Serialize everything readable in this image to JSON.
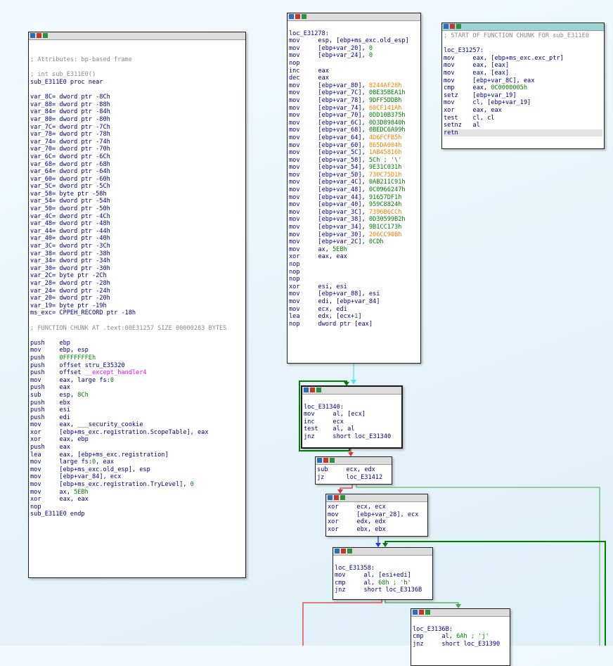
{
  "blocks": {
    "left": {
      "lines": [
        {
          "t": ""
        },
        {
          "t": ""
        },
        {
          "c": "cm",
          "t": "; Attributes: bp-based frame"
        },
        {
          "t": ""
        },
        {
          "c": "cm",
          "t": "; int sub_E311E0()"
        },
        {
          "c": "pr",
          "t": "sub_E311E0 proc near"
        },
        {
          "t": ""
        },
        {
          "c": "pr",
          "t": "var_8C= dword ptr -8Ch"
        },
        {
          "c": "pr",
          "t": "var_88= dword ptr -88h"
        },
        {
          "c": "pr",
          "t": "var_84= dword ptr -84h"
        },
        {
          "c": "pr",
          "t": "var_80= dword ptr -80h"
        },
        {
          "c": "pr",
          "t": "var_7C= dword ptr -7Ch"
        },
        {
          "c": "pr",
          "t": "var_78= dword ptr -78h"
        },
        {
          "c": "pr",
          "t": "var_74= dword ptr -74h"
        },
        {
          "c": "pr",
          "t": "var_70= dword ptr -70h"
        },
        {
          "c": "pr",
          "t": "var_6C= dword ptr -6Ch"
        },
        {
          "c": "pr",
          "t": "var_68= dword ptr -68h"
        },
        {
          "c": "pr",
          "t": "var_64= dword ptr -64h"
        },
        {
          "c": "pr",
          "t": "var_60= dword ptr -60h"
        },
        {
          "c": "pr",
          "t": "var_5C= dword ptr -5Ch"
        },
        {
          "c": "pr",
          "t": "var_58= byte ptr -58h"
        },
        {
          "c": "pr",
          "t": "var_54= dword ptr -54h"
        },
        {
          "c": "pr",
          "t": "var_50= dword ptr -50h"
        },
        {
          "c": "pr",
          "t": "var_4C= dword ptr -4Ch"
        },
        {
          "c": "pr",
          "t": "var_48= dword ptr -48h"
        },
        {
          "c": "pr",
          "t": "var_44= dword ptr -44h"
        },
        {
          "c": "pr",
          "t": "var_40= dword ptr -40h"
        },
        {
          "c": "pr",
          "t": "var_3C= dword ptr -3Ch"
        },
        {
          "c": "pr",
          "t": "var_38= dword ptr -38h"
        },
        {
          "c": "pr",
          "t": "var_34= dword ptr -34h"
        },
        {
          "c": "pr",
          "t": "var_30= dword ptr -30h"
        },
        {
          "c": "pr",
          "t": "var_2C= byte ptr -2Ch"
        },
        {
          "c": "pr",
          "t": "var_28= dword ptr -28h"
        },
        {
          "c": "pr",
          "t": "var_24= dword ptr -24h"
        },
        {
          "c": "pr",
          "t": "var_20= dword ptr -20h"
        },
        {
          "c": "pr",
          "t": "var_19= byte ptr -19h"
        },
        {
          "c": "pr",
          "t": "ms_exc= CPPEH_RECORD ptr -18h"
        },
        {
          "t": ""
        },
        {
          "c": "cm",
          "t": "; FUNCTION CHUNK AT .text:00E31257 SIZE 00000283 BYTES"
        },
        {
          "t": ""
        },
        {
          "m": "push",
          "a": [
            [
              "r",
              "ebp"
            ]
          ]
        },
        {
          "m": "mov",
          "a": [
            [
              "r",
              "ebp, esp"
            ]
          ]
        },
        {
          "m": "push",
          "a": [
            [
              "n",
              "0FFFFFFFEh"
            ]
          ]
        },
        {
          "m": "push",
          "a": [
            [
              "r",
              "offset stru_E35320"
            ]
          ]
        },
        {
          "m": "push",
          "a": [
            [
              "r",
              "offset "
            ],
            [
              "imp",
              "__except_handler4"
            ]
          ]
        },
        {
          "m": "mov",
          "a": [
            [
              "r",
              "eax, large fs:"
            ],
            [
              "n",
              "0"
            ]
          ]
        },
        {
          "m": "push",
          "a": [
            [
              "r",
              "eax"
            ]
          ]
        },
        {
          "m": "sub",
          "a": [
            [
              "r",
              "esp, "
            ],
            [
              "n",
              "8Ch"
            ]
          ]
        },
        {
          "m": "push",
          "a": [
            [
              "r",
              "ebx"
            ]
          ]
        },
        {
          "m": "push",
          "a": [
            [
              "r",
              "esi"
            ]
          ]
        },
        {
          "m": "push",
          "a": [
            [
              "r",
              "edi"
            ]
          ]
        },
        {
          "m": "mov",
          "a": [
            [
              "r",
              "eax, ___security_cookie"
            ]
          ]
        },
        {
          "m": "xor",
          "a": [
            [
              "r",
              "[ebp+ms_exc.registration.ScopeTable], eax"
            ]
          ]
        },
        {
          "m": "xor",
          "a": [
            [
              "r",
              "eax, ebp"
            ]
          ]
        },
        {
          "m": "push",
          "a": [
            [
              "r",
              "eax"
            ]
          ]
        },
        {
          "m": "lea",
          "a": [
            [
              "r",
              "eax, [ebp+ms_exc.registration]"
            ]
          ]
        },
        {
          "m": "mov",
          "a": [
            [
              "r",
              "large fs:"
            ],
            [
              "n",
              "0"
            ],
            [
              "r",
              ", eax"
            ]
          ]
        },
        {
          "m": "mov",
          "a": [
            [
              "r",
              "[ebp+ms_exc.old_esp], esp"
            ]
          ]
        },
        {
          "m": "mov",
          "a": [
            [
              "r",
              "[ebp+var_84], ecx"
            ]
          ]
        },
        {
          "m": "mov",
          "a": [
            [
              "r",
              "[ebp+ms_exc.registration.TryLevel], "
            ],
            [
              "n",
              "0"
            ]
          ]
        },
        {
          "m": "mov",
          "a": [
            [
              "r",
              "ax, "
            ],
            [
              "n",
              "5EBh"
            ]
          ]
        },
        {
          "m": "xor",
          "a": [
            [
              "r",
              "eax, eax"
            ]
          ]
        },
        {
          "m": "nop",
          "a": []
        },
        {
          "c": "pr",
          "t": "sub_E311E0 endp"
        }
      ]
    },
    "mid": {
      "lines": [
        {
          "t": ""
        },
        {
          "c": "lbl",
          "t": "loc_E31278:"
        },
        {
          "m": "mov",
          "a": [
            [
              "r",
              "esp, [ebp+ms_exc.old_esp]"
            ]
          ]
        },
        {
          "m": "mov",
          "a": [
            [
              "r",
              "[ebp+var_20], "
            ],
            [
              "n",
              "0"
            ]
          ]
        },
        {
          "m": "mov",
          "a": [
            [
              "r",
              "[ebp+var_24], "
            ],
            [
              "n",
              "0"
            ]
          ]
        },
        {
          "m": "nop",
          "a": []
        },
        {
          "m": "inc",
          "a": [
            [
              "r",
              "eax"
            ]
          ]
        },
        {
          "m": "dec",
          "a": [
            [
              "r",
              "eax"
            ]
          ]
        },
        {
          "m": "mov",
          "a": [
            [
              "r",
              "[ebp+var_80], "
            ],
            [
              "or",
              "8244AF28h"
            ]
          ]
        },
        {
          "m": "mov",
          "a": [
            [
              "r",
              "[ebp+var_7C], "
            ],
            [
              "n",
              "0BE35BEA1h"
            ]
          ]
        },
        {
          "m": "mov",
          "a": [
            [
              "r",
              "[ebp+var_78], "
            ],
            [
              "n",
              "9DFF5DDBh"
            ]
          ]
        },
        {
          "m": "mov",
          "a": [
            [
              "r",
              "[ebp+var_74], "
            ],
            [
              "or",
              "60CF141Ah"
            ]
          ]
        },
        {
          "m": "mov",
          "a": [
            [
              "r",
              "[ebp+var_70], "
            ],
            [
              "n",
              "0DD10B375h"
            ]
          ]
        },
        {
          "m": "mov",
          "a": [
            [
              "r",
              "[ebp+var_6C], "
            ],
            [
              "n",
              "0D3D89840h"
            ]
          ]
        },
        {
          "m": "mov",
          "a": [
            [
              "r",
              "[ebp+var_68], "
            ],
            [
              "n",
              "0BEDC6A99h"
            ]
          ]
        },
        {
          "m": "mov",
          "a": [
            [
              "r",
              "[ebp+var_64], "
            ],
            [
              "or",
              "4D6FCFB5h"
            ]
          ]
        },
        {
          "m": "mov",
          "a": [
            [
              "r",
              "[ebp+var_60], "
            ],
            [
              "or",
              "865DA004h"
            ]
          ]
        },
        {
          "m": "mov",
          "a": [
            [
              "r",
              "[ebp+var_5C], "
            ],
            [
              "or",
              "1AB45816h"
            ]
          ]
        },
        {
          "m": "mov",
          "a": [
            [
              "r",
              "[ebp+var_58], "
            ],
            [
              "n",
              "5Ch ; '\\'"
            ]
          ]
        },
        {
          "m": "mov",
          "a": [
            [
              "r",
              "[ebp+var_54], "
            ],
            [
              "n",
              "9E31C031h"
            ]
          ]
        },
        {
          "m": "mov",
          "a": [
            [
              "r",
              "[ebp+var_50], "
            ],
            [
              "or",
              "730C75D1h"
            ]
          ]
        },
        {
          "m": "mov",
          "a": [
            [
              "r",
              "[ebp+var_4C], "
            ],
            [
              "n",
              "0AB211C91h"
            ]
          ]
        },
        {
          "m": "mov",
          "a": [
            [
              "r",
              "[ebp+var_48], "
            ],
            [
              "n",
              "0C0966247h"
            ]
          ]
        },
        {
          "m": "mov",
          "a": [
            [
              "r",
              "[ebp+var_44], "
            ],
            [
              "n",
              "91657DF1h"
            ]
          ]
        },
        {
          "m": "mov",
          "a": [
            [
              "r",
              "[ebp+var_40], "
            ],
            [
              "n",
              "959C8824h"
            ]
          ]
        },
        {
          "m": "mov",
          "a": [
            [
              "r",
              "[ebp+var_3C], "
            ],
            [
              "or",
              "7396B6CCh"
            ]
          ]
        },
        {
          "m": "mov",
          "a": [
            [
              "r",
              "[ebp+var_38], "
            ],
            [
              "n",
              "0D30599B2h"
            ]
          ]
        },
        {
          "m": "mov",
          "a": [
            [
              "r",
              "[ebp+var_34], "
            ],
            [
              "n",
              "9B1CC173h"
            ]
          ]
        },
        {
          "m": "mov",
          "a": [
            [
              "r",
              "[ebp+var_30], "
            ],
            [
              "or",
              "206CC90Bh"
            ]
          ]
        },
        {
          "m": "mov",
          "a": [
            [
              "r",
              "[ebp+var_2C], "
            ],
            [
              "n",
              "0CDh"
            ]
          ]
        },
        {
          "m": "mov",
          "a": [
            [
              "r",
              "ax, "
            ],
            [
              "n",
              "5EBh"
            ]
          ]
        },
        {
          "m": "xor",
          "a": [
            [
              "r",
              "eax, eax"
            ]
          ]
        },
        {
          "m": "nop",
          "a": []
        },
        {
          "m": "nop",
          "a": []
        },
        {
          "m": "nop",
          "a": []
        },
        {
          "m": "xor",
          "a": [
            [
              "r",
              "esi, esi"
            ]
          ]
        },
        {
          "m": "mov",
          "a": [
            [
              "r",
              "[ebp+var_88], esi"
            ]
          ]
        },
        {
          "m": "mov",
          "a": [
            [
              "r",
              "edi, [ebp+var_84]"
            ]
          ]
        },
        {
          "m": "mov",
          "a": [
            [
              "r",
              "ecx, edi"
            ]
          ]
        },
        {
          "m": "lea",
          "a": [
            [
              "r",
              "edx, [ecx+"
            ],
            [
              "n",
              "1"
            ],
            [
              "r",
              "]"
            ]
          ]
        },
        {
          "m": "nop",
          "a": [
            [
              "r",
              "dword ptr [eax]"
            ]
          ]
        }
      ]
    },
    "right": {
      "lines": [
        {
          "c": "cm",
          "t": "; START OF FUNCTION CHUNK FOR sub_E311E0"
        },
        {
          "t": ""
        },
        {
          "c": "lbl",
          "t": "loc_E31257:"
        },
        {
          "m": "mov",
          "a": [
            [
              "r",
              "eax, [ebp+ms_exc.exc_ptr]"
            ]
          ]
        },
        {
          "m": "mov",
          "a": [
            [
              "r",
              "eax, [eax]"
            ]
          ]
        },
        {
          "m": "mov",
          "a": [
            [
              "r",
              "eax, [eax]"
            ]
          ]
        },
        {
          "m": "mov",
          "a": [
            [
              "r",
              "[ebp+var_8C], eax"
            ]
          ]
        },
        {
          "m": "cmp",
          "a": [
            [
              "r",
              "eax, "
            ],
            [
              "n",
              "0C0000005h"
            ]
          ]
        },
        {
          "m": "setz",
          "a": [
            [
              "r",
              "[ebp+var_19]"
            ]
          ]
        },
        {
          "m": "mov",
          "a": [
            [
              "r",
              "cl, [ebp+var_19]"
            ]
          ]
        },
        {
          "m": "xor",
          "a": [
            [
              "r",
              "eax, eax"
            ]
          ]
        },
        {
          "m": "test",
          "a": [
            [
              "r",
              "cl, cl"
            ]
          ]
        },
        {
          "m": "setnz",
          "a": [
            [
              "r",
              "al"
            ]
          ]
        },
        {
          "m": "retn",
          "a": [],
          "hl": true
        }
      ]
    },
    "b1340": {
      "lines": [
        {
          "t": ""
        },
        {
          "c": "lbl",
          "t": "loc_E31340:"
        },
        {
          "m": "mov",
          "a": [
            [
              "r",
              "al, [ecx]"
            ]
          ]
        },
        {
          "m": "inc",
          "a": [
            [
              "r",
              "ecx"
            ]
          ]
        },
        {
          "m": "test",
          "a": [
            [
              "r",
              "al, al"
            ]
          ]
        },
        {
          "m": "jnz",
          "a": [
            [
              "r",
              "short loc_E31340"
            ]
          ]
        }
      ]
    },
    "bsub": {
      "lines": [
        {
          "m": "sub",
          "a": [
            [
              "r",
              "ecx, edx"
            ]
          ]
        },
        {
          "m": "jz",
          "a": [
            [
              "r",
              "loc_E31412"
            ]
          ]
        }
      ]
    },
    "bxor": {
      "lines": [
        {
          "m": "xor",
          "a": [
            [
              "r",
              "ecx, ecx"
            ]
          ]
        },
        {
          "m": "mov",
          "a": [
            [
              "r",
              "[ebp+var_28], ecx"
            ]
          ]
        },
        {
          "m": "xor",
          "a": [
            [
              "r",
              "edx, edx"
            ]
          ]
        },
        {
          "m": "xor",
          "a": [
            [
              "r",
              "ebx, ebx"
            ]
          ]
        }
      ]
    },
    "b1358": {
      "lines": [
        {
          "t": ""
        },
        {
          "c": "lbl",
          "t": "loc_E31358:"
        },
        {
          "m": "mov",
          "a": [
            [
              "r",
              "al, [esi+edi]"
            ]
          ]
        },
        {
          "m": "cmp",
          "a": [
            [
              "r",
              "al, "
            ],
            [
              "n",
              "68h ; 'h'"
            ]
          ]
        },
        {
          "m": "jnz",
          "a": [
            [
              "r",
              "short loc_E3136B"
            ]
          ]
        }
      ]
    },
    "b136b": {
      "lines": [
        {
          "t": ""
        },
        {
          "c": "lbl",
          "t": "loc_E3136B:"
        },
        {
          "m": "cmp",
          "a": [
            [
              "r",
              "al, "
            ],
            [
              "n",
              "6Ah ; 'j'"
            ]
          ]
        },
        {
          "m": "jnz",
          "a": [
            [
              "r",
              "short loc_E31390"
            ]
          ]
        }
      ]
    }
  }
}
